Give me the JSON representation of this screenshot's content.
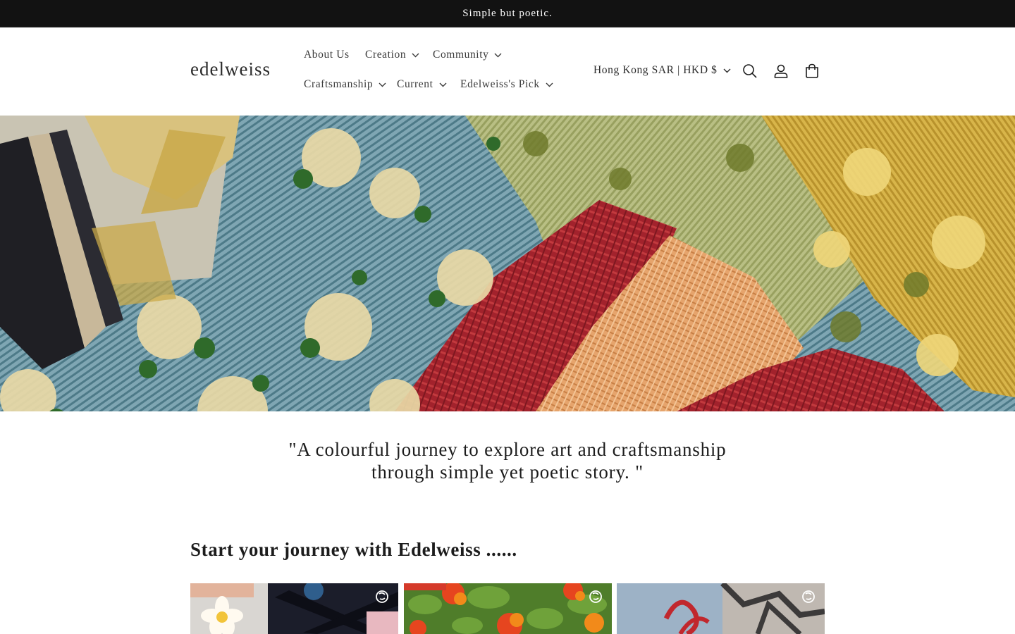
{
  "announcement": {
    "text": "Simple but poetic."
  },
  "header": {
    "logo": "edelweiss",
    "nav": [
      {
        "label": "About Us",
        "has_dropdown": false
      },
      {
        "label": "Creation",
        "has_dropdown": true
      },
      {
        "label": "Community",
        "has_dropdown": true
      },
      {
        "label": "Craftsmanship",
        "has_dropdown": true
      },
      {
        "label": "Current",
        "has_dropdown": true
      },
      {
        "label": "Edelweiss's Pick",
        "has_dropdown": true
      }
    ],
    "region_selector": "Hong Kong SAR | HKD $",
    "icons": [
      "search-icon",
      "account-icon",
      "cart-icon"
    ]
  },
  "hero": {
    "image": "embroidered-fabric-swatches"
  },
  "quote": {
    "line1": "\"A colourful journey to explore art and craftsmanship",
    "line2": "through simple yet poetic story. \""
  },
  "journey": {
    "title": "Start your journey with Edelweiss ......",
    "cards": [
      {
        "image": "frangipani-flower-and-ribbons",
        "icon": "instagram-reel-icon"
      },
      {
        "image": "orange-flowers-and-leaves",
        "icon": "instagram-reel-icon"
      },
      {
        "image": "red-sketch-on-blue-card",
        "icon": "instagram-reel-icon"
      }
    ]
  },
  "colors": {
    "announcement_bg": "#121212",
    "text": "#1c1c1c",
    "background": "#ffffff"
  }
}
